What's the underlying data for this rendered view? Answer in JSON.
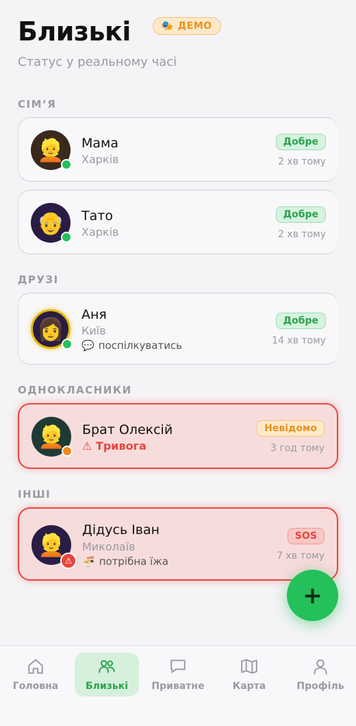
{
  "header": {
    "title": "Близькі",
    "demo_badge": "ДЕМО",
    "demo_icon": "🎭",
    "subtitle": "Статус у реальному часі"
  },
  "sections": {
    "family": "СІМ’Я",
    "friends": "ДРУЗІ",
    "classmates": "ОДНОКЛАСНИКИ",
    "others": "ІНШІ"
  },
  "contacts": [
    {
      "name": "Мама",
      "city": "Харків",
      "status": "Добре",
      "time": "2 хв тому",
      "emoji": "👱",
      "avatar_bg": "#3a2a1c",
      "dot_color": "#24c05a"
    },
    {
      "name": "Тато",
      "city": "Харків",
      "status": "Добре",
      "time": "2 хв тому",
      "emoji": "👴",
      "avatar_bg": "#2a1d45",
      "dot_color": "#24c05a"
    },
    {
      "name": "Аня",
      "city": "Київ",
      "note": "поспілкуватись",
      "note_icon": "💬",
      "status": "Добре",
      "time": "14 хв тому",
      "emoji": "👩",
      "avatar_bg": "#2a1d45",
      "dot_color": "#24c05a"
    },
    {
      "name": "Брат Олексій",
      "alarm": "⚠ Тривога",
      "status": "Невідомо",
      "time": "3 год тому",
      "emoji": "👱",
      "avatar_bg": "#1f3a34",
      "dot_color": "#f08a1c"
    },
    {
      "name": "Дідусь Іван",
      "city": "Миколаїв",
      "note": "потрібна їжа",
      "note_icon": "🍜",
      "status": "SOS",
      "time": "7 хв тому",
      "emoji": "👱",
      "avatar_bg": "#2a1d45",
      "sos_icon": "⚠"
    }
  ],
  "fab": {
    "label": "+"
  },
  "tabs": [
    {
      "label": "Головна",
      "icon": "home-icon"
    },
    {
      "label": "Близькі",
      "icon": "people-icon"
    },
    {
      "label": "Приватне",
      "icon": "chat-icon"
    },
    {
      "label": "Карта",
      "icon": "map-icon"
    },
    {
      "label": "Профіль",
      "icon": "profile-icon"
    }
  ],
  "colors": {
    "accent": "#24c05a",
    "alert": "#e8463c",
    "warning": "#e8921f",
    "background": "#f4f4f6"
  }
}
